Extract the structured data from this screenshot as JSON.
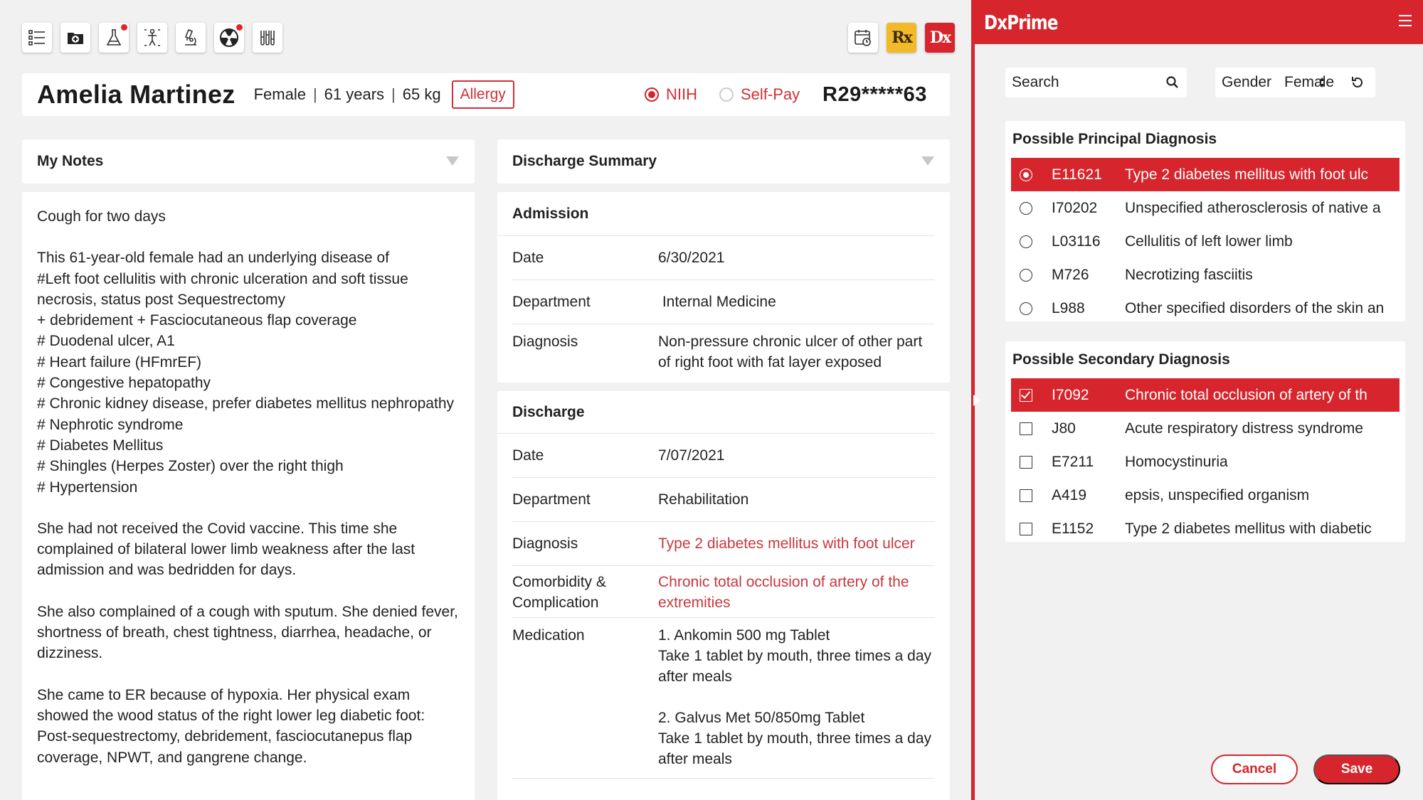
{
  "toolbar": {
    "left_icons": [
      {
        "icon": "list-icon",
        "badge": false
      },
      {
        "icon": "medical-folder-icon",
        "badge": false
      },
      {
        "icon": "lab-flask-icon",
        "badge": true
      },
      {
        "icon": "body-scan-icon",
        "badge": false
      },
      {
        "icon": "microscope-icon",
        "badge": false
      },
      {
        "icon": "radiation-icon",
        "badge": true
      },
      {
        "icon": "test-tubes-icon",
        "badge": false
      }
    ],
    "calendar_icon": "calendar-clock-icon",
    "rx_label": "Rx",
    "dx_label": "Dx"
  },
  "patient": {
    "name": "Amelia Martinez",
    "gender": "Female",
    "age": "61 years",
    "weight": "65 kg",
    "sep": "|",
    "allergy_label": "Allergy",
    "insurance_options": [
      "NIIH",
      "Self-Pay"
    ],
    "insurance_selected": "NIIH",
    "id": "R29*****63"
  },
  "notes": {
    "title": "My Notes",
    "paragraphs": [
      "Cough for two days",
      "This 61-year-old female had an underlying disease of\n#Left foot cellulitis with chronic ulceration and soft tissue necrosis, status post Sequestrectomy\n+ debridement + Fasciocutaneous flap coverage\n# Duodenal ulcer, A1\n# Heart failure (HFmrEF)\n# Congestive hepatopathy\n# Chronic kidney disease, prefer diabetes mellitus nephropathy\n# Nephrotic syndrome\n# Diabetes Mellitus\n# Shingles (Herpes Zoster) over the right thigh\n# Hypertension",
      "She had not received the Covid vaccine. This time she complained of bilateral lower limb weakness after the last admission and was bedridden for days.",
      "She also complained of a cough with sputum. She denied fever, shortness of breath, chest tightness, diarrhea, headache, or dizziness.",
      "She came to ER because of hypoxia. Her physical exam showed the wood status of the right lower leg diabetic foot: Post-sequestrectomy, debridement, fasciocutanepus flap coverage, NPWT, and gangrene change."
    ]
  },
  "discharge_summary": {
    "title": "Discharge Summary",
    "admission": {
      "title": "Admission",
      "rows": [
        {
          "label": "Date",
          "value": "6/30/2021"
        },
        {
          "label": "Department",
          "value": " Internal Medicine"
        },
        {
          "label": "Diagnosis",
          "value": "Non-pressure chronic ulcer of other part of right foot with fat layer exposed"
        }
      ]
    },
    "discharge": {
      "title": "Discharge",
      "rows": [
        {
          "label": "Date",
          "value": "7/07/2021"
        },
        {
          "label": "Department",
          "value": "Rehabilitation"
        },
        {
          "label": "Diagnosis",
          "value": "Type 2 diabetes mellitus with foot ulcer"
        },
        {
          "label": "Comorbidity & Complication",
          "value": "Chronic total occlusion of artery of the extremities"
        },
        {
          "label": "Medication",
          "value": "1. Ankomin 500 mg Tablet\nTake 1 tablet by mouth, three times a day after meals\n\n2. Galvus Met 50/850mg Tablet\nTake 1 tablet by mouth, three times a day after meals"
        }
      ]
    }
  },
  "dxprime": {
    "brand": "DxPrime",
    "search_placeholder": "Search",
    "gender_label": "Gender",
    "gender_value": "Female",
    "principal": {
      "title": "Possible Principal Diagnosis",
      "items": [
        {
          "code": "E11621",
          "desc": "Type 2 diabetes mellitus with foot ulc",
          "selected": true
        },
        {
          "code": "I70202",
          "desc": "Unspecified atherosclerosis of native a",
          "selected": false
        },
        {
          "code": "L03116",
          "desc": "Cellulitis of left lower limb",
          "selected": false
        },
        {
          "code": "M726",
          "desc": "Necrotizing fasciitis",
          "selected": false
        },
        {
          "code": "L988",
          "desc": "Other specified disorders of the skin an",
          "selected": false
        }
      ]
    },
    "secondary": {
      "title": "Possible Secondary Diagnosis",
      "items": [
        {
          "code": "I7092",
          "desc": "Chronic total occlusion of artery of th",
          "selected": true
        },
        {
          "code": "J80",
          "desc": "Acute respiratory distress syndrome",
          "selected": false
        },
        {
          "code": "E7211",
          "desc": "Homocystinuria",
          "selected": false
        },
        {
          "code": "A419",
          "desc": "epsis, unspecified organism",
          "selected": false
        },
        {
          "code": "E1152",
          "desc": "Type 2 diabetes mellitus with diabetic",
          "selected": false
        }
      ]
    },
    "cancel_label": "Cancel",
    "save_label": "Save"
  },
  "colors": {
    "accent": "#d6252c",
    "rx": "#f2b928",
    "highlight_text": "#c8383d"
  }
}
